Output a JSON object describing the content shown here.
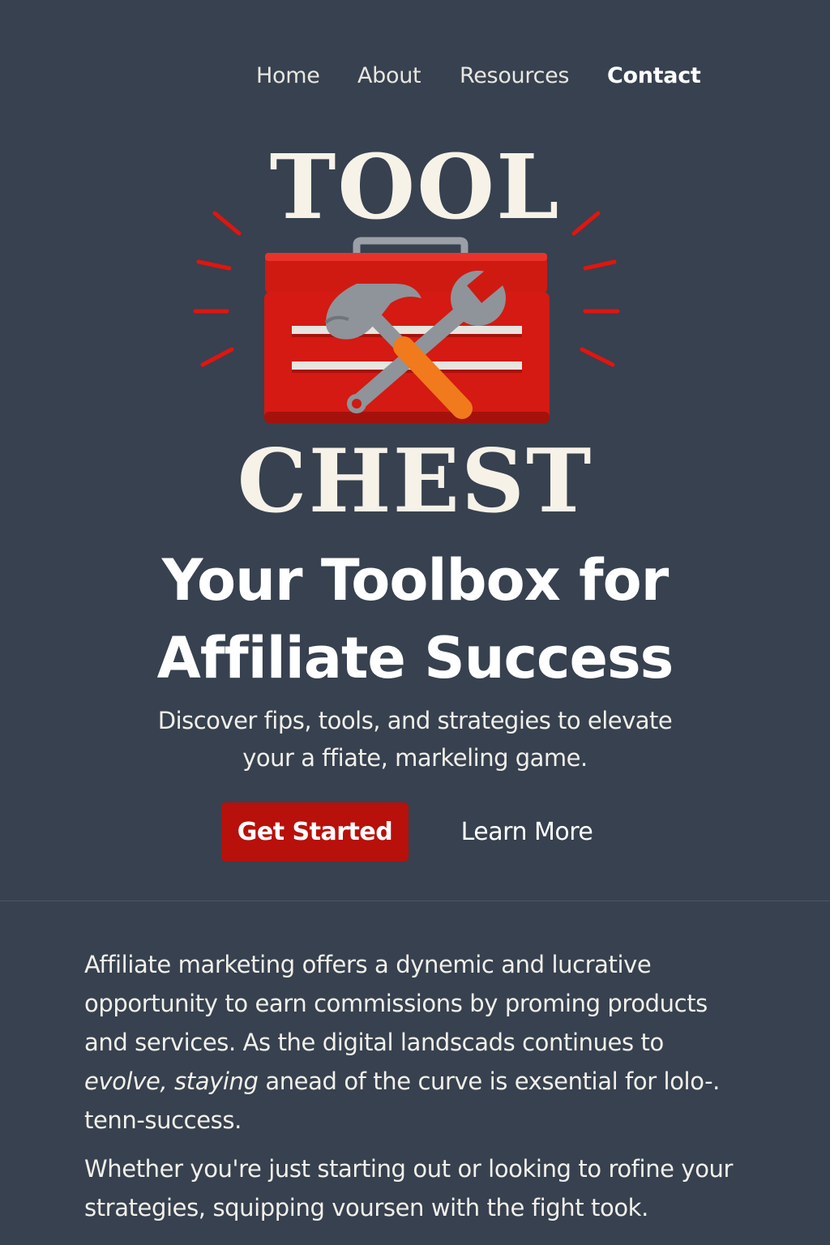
{
  "nav": {
    "items": [
      {
        "label": "Home",
        "active": false
      },
      {
        "label": "About",
        "active": false
      },
      {
        "label": "Resources",
        "active": false
      },
      {
        "label": "Contact",
        "active": true
      }
    ]
  },
  "logo": {
    "top_word": "TOOL",
    "bottom_word": "CHEST",
    "icon": "toolbox-hammer-wrench-icon"
  },
  "hero": {
    "headline_line1": "Your Toolbox for",
    "headline_line2": "Affiliate Success",
    "subtext_line1": "Discover fips, tools, and strategies to elevate",
    "subtext_line2": "your a ffiate, markeling game.",
    "primary_button": "Get Started",
    "secondary_button": "Learn More"
  },
  "content": {
    "p1_line1": "Affiliate marketing offers a dynemic and lucrative",
    "p1_line2": "opportunity to earn commissions by proming products",
    "p1_line3": "and services. As the digital landscads continues to",
    "p1_line4_italic": "evolve, staying",
    "p1_line4_rest": " anead of the curve is exsential for lolo-.",
    "p1_line5": "tenn-success.",
    "p2_line1": "Whether you're just starting out or looking to rofine your",
    "p2_line2": "strategies, squipping voursen with the fight took."
  },
  "colors": {
    "background": "#37414f",
    "accent": "#b8100b",
    "logo_text": "#f6f2e8",
    "toolbox_red": "#d41a12",
    "burst_red": "#e3140f",
    "wrench_handle": "#f07a1c"
  }
}
